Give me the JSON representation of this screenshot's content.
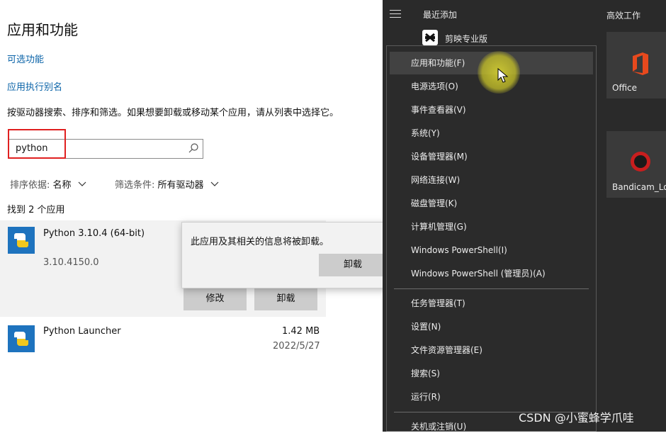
{
  "settings": {
    "title": "应用和功能",
    "link_optional": "可选功能",
    "link_alias": "应用执行别名",
    "description": "按驱动器搜索、排序和筛选。如果想要卸载或移动某个应用，请从列表中选择它。",
    "search_value": "python",
    "sort_label": "排序依据:",
    "sort_value": "名称",
    "filter_label": "筛选条件:",
    "filter_value": "所有驱动器",
    "found_text": "找到 2 个应用",
    "apps": [
      {
        "name": "Python 3.10.4 (64-bit)",
        "version": "3.10.4150.0"
      },
      {
        "name": "Python Launcher",
        "size": "1.42 MB",
        "date": "2022/5/27"
      }
    ],
    "modify_label": "修改",
    "uninstall_label": "卸载",
    "popup_message": "此应用及其相关的信息将被卸载。",
    "popup_uninstall_label": "卸载"
  },
  "start": {
    "recent_title": "最近添加",
    "recent_app": "剪映专业版",
    "productivity_title": "高效工作",
    "tiles": [
      {
        "label": "Office"
      },
      {
        "label": "Bandicam_Lo..."
      }
    ]
  },
  "winx_menu": {
    "items": [
      "应用和功能(F)",
      "电源选项(O)",
      "事件查看器(V)",
      "系统(Y)",
      "设备管理器(M)",
      "网络连接(W)",
      "磁盘管理(K)",
      "计算机管理(G)",
      "Windows PowerShell(I)",
      "Windows PowerShell (管理员)(A)",
      "任务管理器(T)",
      "设置(N)",
      "文件资源管理器(E)",
      "搜索(S)",
      "运行(R)",
      "关机或注销(U)"
    ]
  },
  "watermark": "CSDN @小蜜蜂学爪哇",
  "colors": {
    "link": "#0a63a8",
    "highlight_red": "#e02020",
    "menu_bg": "#2b2b2b",
    "cursor_glow": "#d7d232"
  }
}
